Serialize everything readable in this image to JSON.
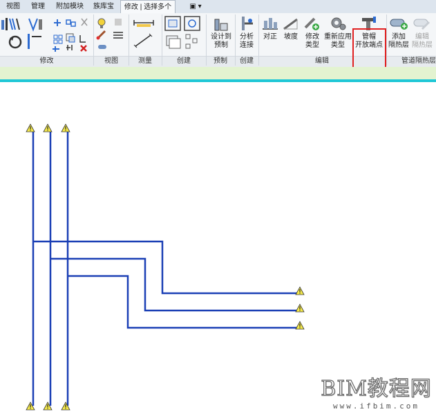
{
  "tabs": [
    {
      "label": "视图",
      "active": false
    },
    {
      "label": "管理",
      "active": false
    },
    {
      "label": "附加模块",
      "active": false
    },
    {
      "label": "族库宝",
      "active": false
    },
    {
      "label": "修改 | 选择多个",
      "active": true
    },
    {
      "label": "▣ ▾",
      "active": false
    }
  ],
  "panels": {
    "modify": "修改",
    "view": "视图",
    "measure": "测量",
    "create": "创建",
    "prefab": "预制",
    "create2": "创建",
    "edit": "编辑",
    "insulation": "管道隔热层"
  },
  "buttons": {
    "design_prefab": "设计到\n预制",
    "design_prefab_l1": "设计到",
    "design_prefab_l2": "预制",
    "analyze_l1": "分析",
    "analyze_l2": "连接",
    "justify": "对正",
    "slope": "坡度",
    "modify_type_l1": "修改",
    "modify_type_l2": "类型",
    "reapply_type_l1": "重新应用",
    "reapply_type_l2": "类型",
    "cap_l1": "管帽",
    "cap_l2": "开放端点",
    "add_ins_l1": "添加",
    "add_ins_l2": "隔热层",
    "edit_ins_l1": "编辑",
    "edit_ins_l2": "隔热层"
  },
  "colors": {
    "pipe": "#1a3fb5",
    "warning_fill": "#f4e94a",
    "highlight": "#e02020",
    "accent_strip": "#1fc7d6"
  },
  "watermark": {
    "title": "BIM教程网",
    "url": "www.ifbim.com"
  }
}
